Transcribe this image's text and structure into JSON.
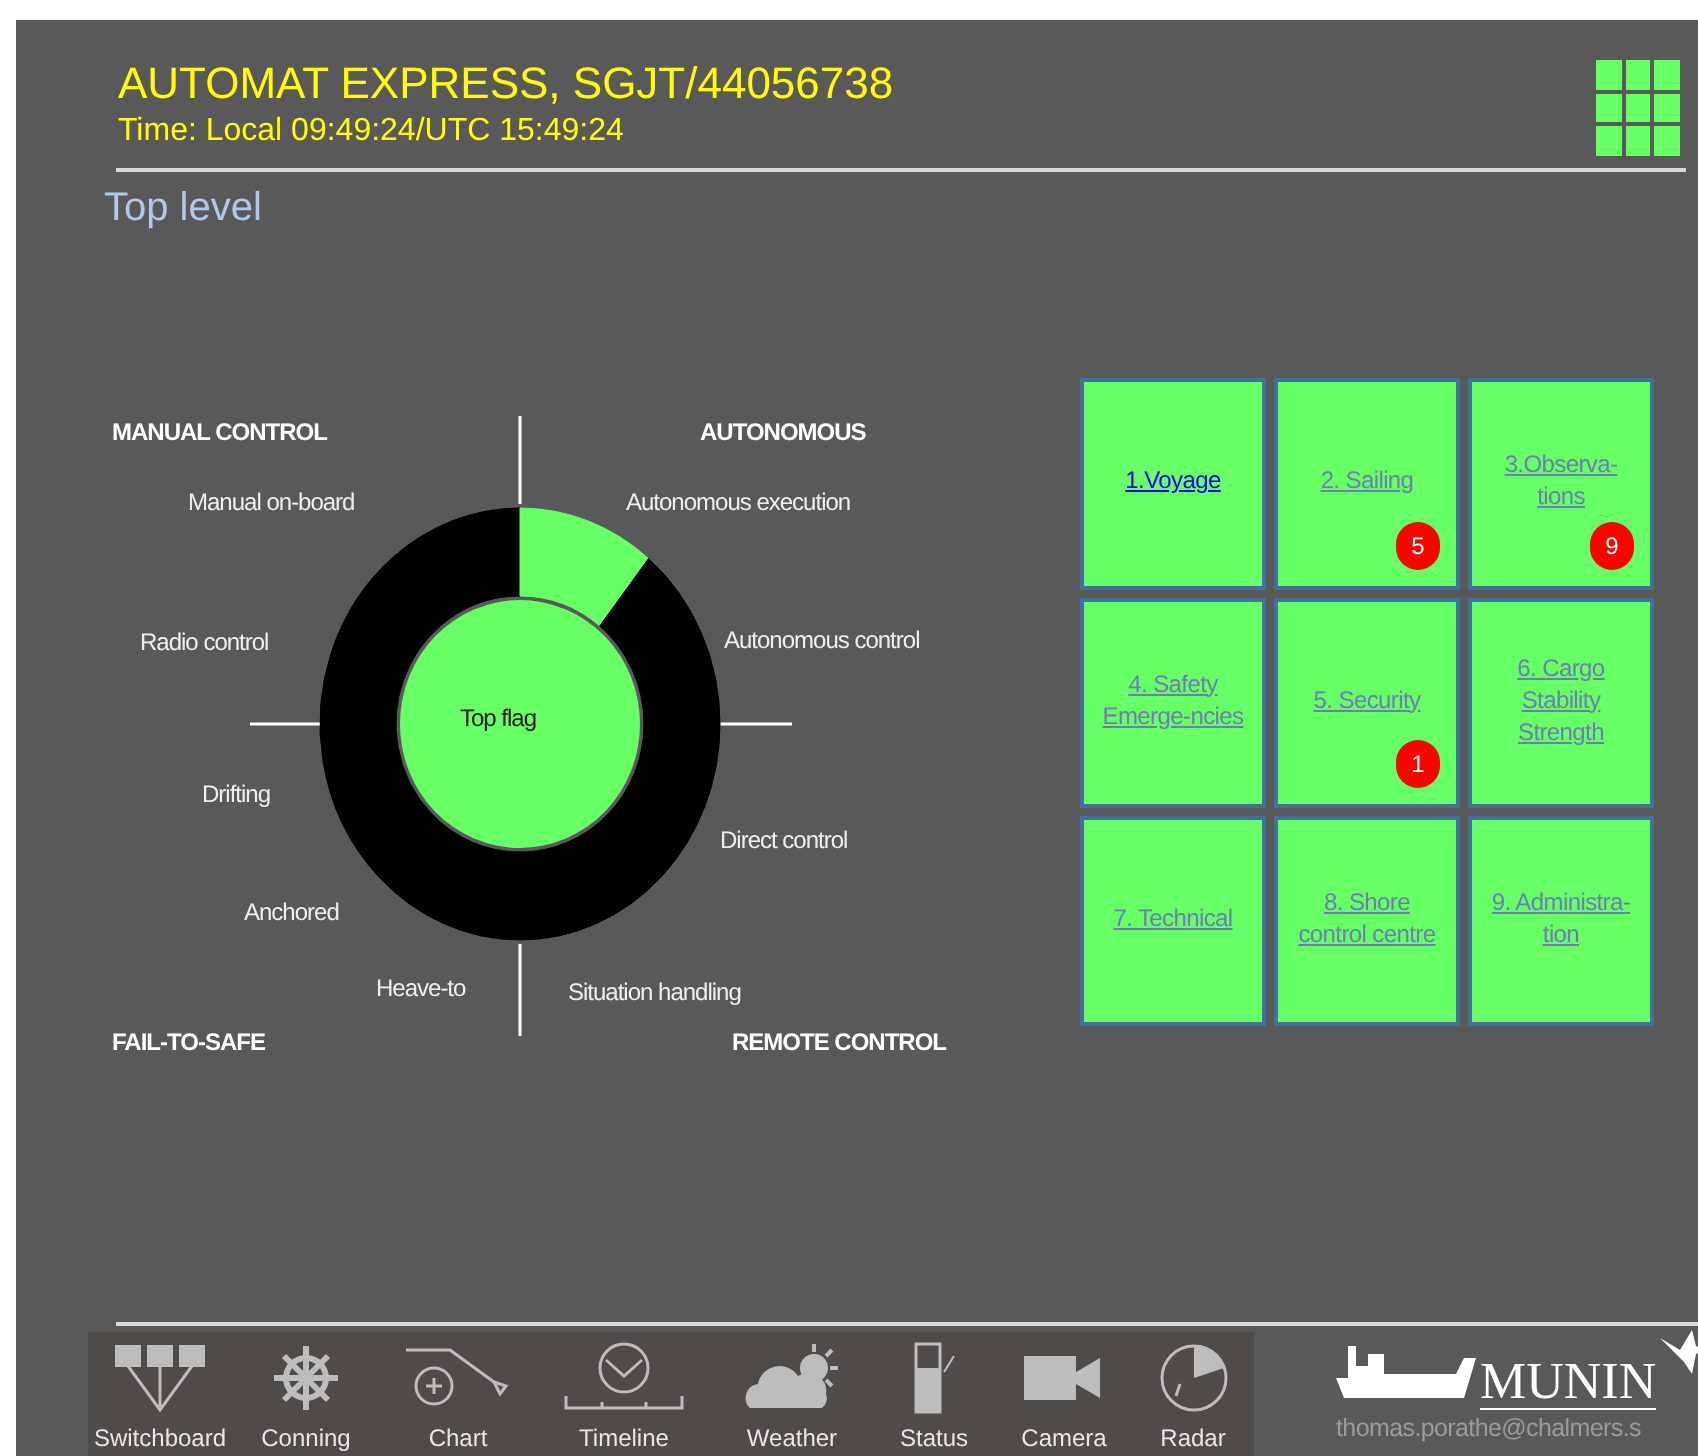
{
  "vessel": {
    "title": "AUTOMAT EXPRESS, SGJT/44056738",
    "time": "Time: Local 09:49:24/UTC 15:49:24"
  },
  "breadcrumb": "Top level",
  "diagram": {
    "center": "Top flag",
    "quadrants": [
      "MANUAL CONTROL",
      "AUTONOMOUS",
      "FAIL-TO-SAFE",
      "REMOTE CONTROL"
    ],
    "modes": [
      {
        "label": "Manual on-board",
        "active": false
      },
      {
        "label": "Autonomous execution",
        "active": true
      },
      {
        "label": "Radio control",
        "active": false
      },
      {
        "label": "Autonomous control",
        "active": false
      },
      {
        "label": "Drifting",
        "active": false
      },
      {
        "label": "Direct control",
        "active": false
      },
      {
        "label": "Anchored",
        "active": false
      },
      {
        "label": "Heave-to",
        "active": false
      },
      {
        "label": "Situation handling",
        "active": false
      }
    ]
  },
  "tiles": [
    {
      "label": "1.Voyage",
      "selected": true
    },
    {
      "label": "2. Sailing",
      "selected": false,
      "badge": "5"
    },
    {
      "label": "3.Observa-\ntions",
      "selected": false,
      "badge": "9"
    },
    {
      "label": "4. Safety\nEmerge-ncies",
      "selected": false
    },
    {
      "label": "5. Security",
      "selected": false,
      "badge": "1"
    },
    {
      "label": "6. Cargo\nStability\nStrength",
      "selected": false
    },
    {
      "label": "7. Technical",
      "selected": false
    },
    {
      "label": "8. Shore\ncontrol centre",
      "selected": false
    },
    {
      "label": "9. Administra-\ntion",
      "selected": false
    }
  ],
  "toolbar": [
    {
      "label": "Switchboard",
      "kind": "switchboard"
    },
    {
      "label": "Conning",
      "kind": "conning"
    },
    {
      "label": "Chart",
      "kind": "chart"
    },
    {
      "label": "Timeline",
      "kind": "timeline"
    },
    {
      "label": "Weather",
      "kind": "weather"
    },
    {
      "label": "Status",
      "kind": "status"
    },
    {
      "label": "Camera",
      "kind": "camera"
    },
    {
      "label": "Radar",
      "kind": "radar"
    }
  ],
  "logo": {
    "text": "MUNIN",
    "email": "thomas.porathe@chalmers.s"
  }
}
